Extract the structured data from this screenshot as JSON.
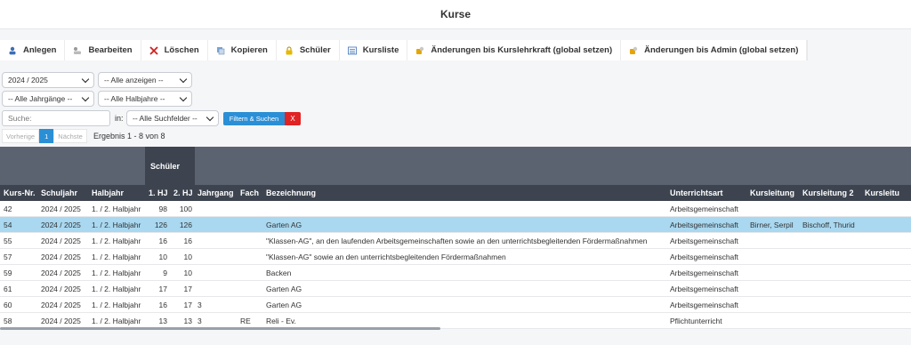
{
  "window": {
    "title": "Kurse"
  },
  "toolbar": {
    "buttons": [
      {
        "label": "Anlegen",
        "icon": "user-add-icon"
      },
      {
        "label": "Bearbeiten",
        "icon": "edit-icon"
      },
      {
        "label": "Löschen",
        "icon": "delete-x-icon"
      },
      {
        "label": "Kopieren",
        "icon": "copy-icon"
      },
      {
        "label": "Schüler",
        "icon": "student-lock-icon"
      },
      {
        "label": "Kursliste",
        "icon": "list-icon"
      },
      {
        "label": "Änderungen bis Kurslehrkraft (global setzen)",
        "icon": "key-lock-icon"
      },
      {
        "label": "Änderungen bis Admin (global setzen)",
        "icon": "key-lock-icon"
      }
    ]
  },
  "filters": {
    "schuljahr": "2024 / 2025",
    "anzeige": "-- Alle anzeigen --",
    "jahrgaenge": "-- Alle Jahrgänge --",
    "halbjahre": "-- Alle Halbjahre --",
    "search_placeholder": "Suche:",
    "in_label": "in:",
    "suchfelder": "-- Alle Suchfelder --",
    "filter_button": "Filtern & Suchen",
    "clear_button": "X"
  },
  "pager": {
    "prev": "Vorherige",
    "current": "1",
    "next": "Nächste",
    "result": "Ergebnis 1 - 8 von 8"
  },
  "table": {
    "group_header": "Schüler",
    "columns": [
      "Kurs-Nr.",
      "Schuljahr",
      "Halbjahr",
      "1. HJ",
      "2. HJ",
      "Jahrgang",
      "Fach",
      "Bezeichnung",
      "Unterrichtsart",
      "Kursleitung",
      "Kursleitung 2",
      "Kursleitu"
    ],
    "rows": [
      [
        "42",
        "2024 / 2025",
        "1. / 2. Halbjahr",
        "98",
        "100",
        "",
        "",
        "",
        "Arbeitsgemeinschaft",
        "",
        ""
      ],
      [
        "54",
        "2024 / 2025",
        "1. / 2. Halbjahr",
        "126",
        "126",
        "",
        "",
        "Garten AG",
        "Arbeitsgemeinschaft",
        "Birner, Serpil",
        "Bischoff, Thurid"
      ],
      [
        "55",
        "2024 / 2025",
        "1. / 2. Halbjahr",
        "16",
        "16",
        "",
        "",
        "\"Klassen-AG\", an den laufenden Arbeitsgemeinschaften sowie an den unterrichtsbegleitenden Fördermaßnahmen",
        "Arbeitsgemeinschaft",
        "",
        ""
      ],
      [
        "57",
        "2024 / 2025",
        "1. / 2. Halbjahr",
        "10",
        "10",
        "",
        "",
        "\"Klassen-AG\" sowie an den unterrichtsbegleitenden Fördermaßnahmen",
        "Arbeitsgemeinschaft",
        "",
        ""
      ],
      [
        "59",
        "2024 / 2025",
        "1. / 2. Halbjahr",
        "9",
        "10",
        "",
        "",
        "Backen",
        "Arbeitsgemeinschaft",
        "",
        ""
      ],
      [
        "61",
        "2024 / 2025",
        "1. / 2. Halbjahr",
        "17",
        "17",
        "",
        "",
        "Garten AG",
        "Arbeitsgemeinschaft",
        "",
        ""
      ],
      [
        "60",
        "2024 / 2025",
        "1. / 2. Halbjahr",
        "16",
        "17",
        "3",
        "",
        "Garten AG",
        "Arbeitsgemeinschaft",
        "",
        ""
      ],
      [
        "58",
        "2024 / 2025",
        "1. / 2. Halbjahr",
        "13",
        "13",
        "3",
        "RE",
        "Reli - Ev.",
        "Pflichtunterricht",
        "",
        ""
      ]
    ],
    "selected_row": 1
  },
  "colors": {
    "header_dark": "#3d4450",
    "header_mid": "#5b6370",
    "selected_row": "#a9d8f0",
    "accent_blue": "#2b8fd6",
    "danger_red": "#e02323"
  }
}
